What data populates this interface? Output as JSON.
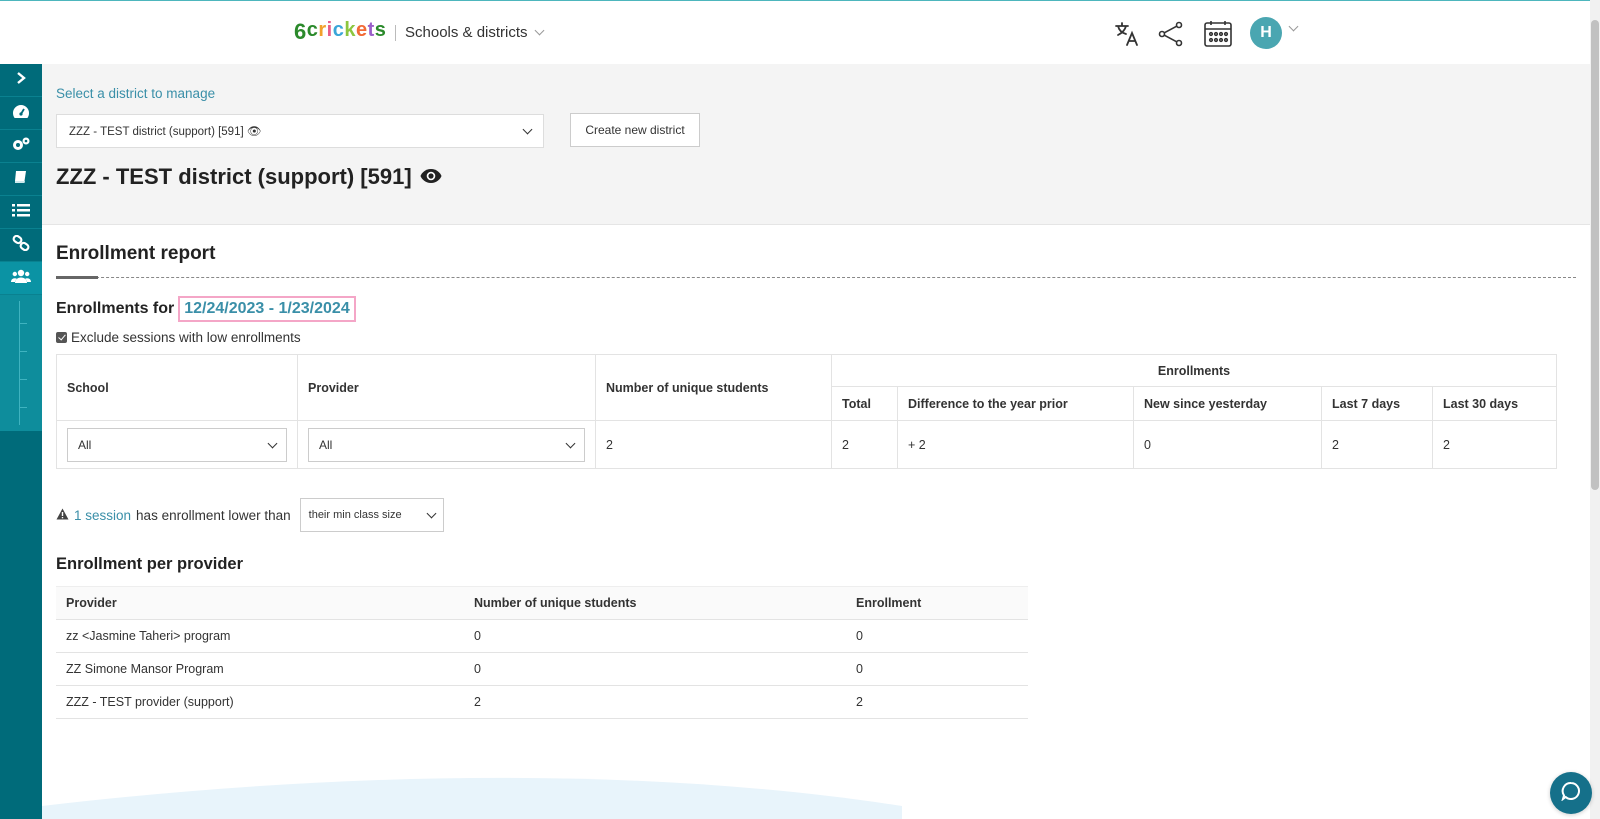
{
  "header": {
    "logo_chars": [
      "6",
      "c",
      "r",
      "i",
      "c",
      "k",
      "e",
      "t",
      "s"
    ],
    "app_switch_label": "Schools & districts",
    "avatar_initial": "H"
  },
  "colors": {
    "accent": "#3a8fa8",
    "sidebar": "#006b7a",
    "sidebar_active": "#0b93a4",
    "avatar": "#4aa6b1",
    "highlight_border": "#f4a6c7"
  },
  "logo_colors": [
    "#2b8a2b",
    "#2b8a2b",
    "#f2a12b",
    "#e85d8a",
    "#3aa6d8",
    "#8cc63f",
    "#f26a36",
    "#9a5fc9",
    "#2b8a2b"
  ],
  "sidebar_icons": [
    "chevron-right-icon",
    "dashboard-icon",
    "gears-icon",
    "book-icon",
    "list-icon",
    "link-icon",
    "users-icon"
  ],
  "district": {
    "select_link": "Select a district to manage",
    "selected": "ZZZ - TEST district (support) [591] 👁",
    "create_button": "Create new district",
    "title": "ZZZ - TEST district (support) [591]"
  },
  "report": {
    "title": "Enrollment report",
    "enrollments_for_label": "Enrollments for",
    "date_range": "12/24/2023 - 1/23/2024",
    "exclude_label": "Exclude sessions with low enrollments"
  },
  "main_table": {
    "headers": {
      "school": "School",
      "provider": "Provider",
      "unique_students": "Number of unique students",
      "enrollments_group": "Enrollments",
      "total": "Total",
      "diff_year_prior": "Difference to the year prior",
      "new_since_yesterday": "New since yesterday",
      "last_7": "Last 7 days",
      "last_30": "Last 30 days"
    },
    "row": {
      "school_filter": "All",
      "provider_filter": "All",
      "unique_students": "2",
      "total": "2",
      "diff_year_prior": "+ 2",
      "new_since_yesterday": "0",
      "last_7": "2",
      "last_30": "2"
    }
  },
  "warning": {
    "link": "1 session",
    "text": "has enrollment lower than",
    "select_value": "their min class size"
  },
  "per_provider": {
    "title": "Enrollment per provider",
    "columns": [
      "Provider",
      "Number of unique students",
      "Enrollment"
    ],
    "rows": [
      {
        "provider": "zz <Jasmine Taheri> program",
        "students": "0",
        "enrollment": "0"
      },
      {
        "provider": "ZZ Simone Mansor Program",
        "students": "0",
        "enrollment": "0"
      },
      {
        "provider": "ZZZ - TEST provider (support)",
        "students": "2",
        "enrollment": "2"
      }
    ]
  }
}
